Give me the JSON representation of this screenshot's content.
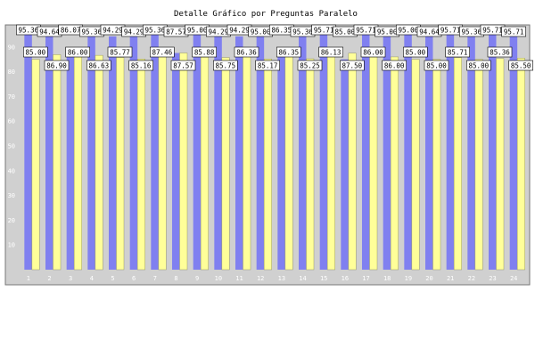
{
  "chart_data": {
    "type": "bar",
    "title": "Detalle Gráfico por Preguntas Paralelo",
    "categories": [
      "1",
      "2",
      "3",
      "4",
      "5",
      "6",
      "7",
      "8",
      "9",
      "10",
      "11",
      "12",
      "13",
      "14",
      "15",
      "16",
      "17",
      "18",
      "19",
      "20",
      "21",
      "22",
      "23",
      "24"
    ],
    "series": [
      {
        "values": [
          95.36,
          94.64,
          86.07,
          95.36,
          94.29,
          94.29,
          95.36,
          87.57,
          95.0,
          94.29,
          94.29,
          95.0,
          86.35,
          95.36,
          95.71,
          85.0,
          95.71,
          95.0,
          95.0,
          94.64,
          95.71,
          95.36,
          95.71,
          95.71
        ]
      },
      {
        "values": [
          85.0,
          86.9,
          86.0,
          86.63,
          85.77,
          85.16,
          87.46,
          87.57,
          85.88,
          85.75,
          86.36,
          85.17,
          86.35,
          85.25,
          86.13,
          87.5,
          86.0,
          86.0,
          85.0,
          85.0,
          85.71,
          85.0,
          85.36,
          85.5
        ]
      }
    ],
    "y_ticks": [
      "10",
      "20",
      "30",
      "40",
      "50",
      "60",
      "70",
      "80",
      "90"
    ],
    "ylim": [
      0,
      100
    ],
    "grid": false,
    "colors": {
      "series1": "#8080f0",
      "series2": "#ffff99",
      "plot_background": "#d0d0d0",
      "tick_text": "#ffffff"
    }
  }
}
